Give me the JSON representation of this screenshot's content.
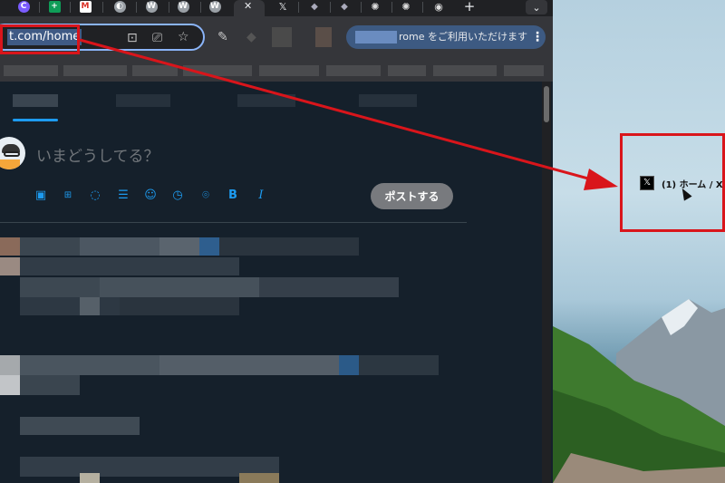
{
  "browser": {
    "tabs": [
      {
        "icon": "chrome-icon",
        "color": "#7b5cff",
        "glyph": "C"
      },
      {
        "icon": "sheets-icon",
        "color": "#0f9d58",
        "glyph": "+"
      },
      {
        "icon": "gmail-icon",
        "color": "#ffffff",
        "glyph": "M"
      },
      {
        "icon": "globe-icon",
        "color": "#9aa0a6",
        "glyph": "◐"
      },
      {
        "icon": "wordpress-icon",
        "color": "#9aa0a6",
        "glyph": "W"
      },
      {
        "icon": "wordpress-icon",
        "color": "#9aa0a6",
        "glyph": "W"
      },
      {
        "icon": "wordpress-icon",
        "color": "#9aa0a6",
        "glyph": "W"
      }
    ],
    "active_tab_close": "✕",
    "tabs_right": [
      {
        "icon": "x-icon",
        "glyph": "𝕏"
      },
      {
        "icon": "app-icon",
        "glyph": "◆"
      },
      {
        "icon": "app-icon",
        "glyph": "◆"
      },
      {
        "icon": "openai-icon",
        "glyph": "✺"
      },
      {
        "icon": "openai-icon",
        "glyph": "✺"
      },
      {
        "icon": "chrome-icon",
        "glyph": "◉"
      }
    ],
    "new_tab": "+",
    "tab_search": "⌄",
    "url": "x.com/home",
    "url_visible": "t.com/home",
    "promo_text": "rome をご利用いただけます",
    "promo_menu": "⋮"
  },
  "x": {
    "compose_placeholder": "いまどうしてる？",
    "post_button": "ポストする",
    "tools": [
      "image-icon",
      "gif-icon",
      "grok-icon",
      "poll-icon",
      "emoji-icon",
      "schedule-icon",
      "location-icon",
      "bold-icon",
      "italic-icon"
    ],
    "tool_glyphs": [
      "▣",
      "⊞",
      "◌",
      "☰",
      "☺",
      "◷",
      "⌾",
      "B",
      "I"
    ]
  },
  "desktop": {
    "dragged_tab_title": "(1) ホーム / X"
  },
  "colors": {
    "annotation_red": "#d9151b",
    "x_blue": "#1d9bf0",
    "x_bg": "#15202b"
  }
}
